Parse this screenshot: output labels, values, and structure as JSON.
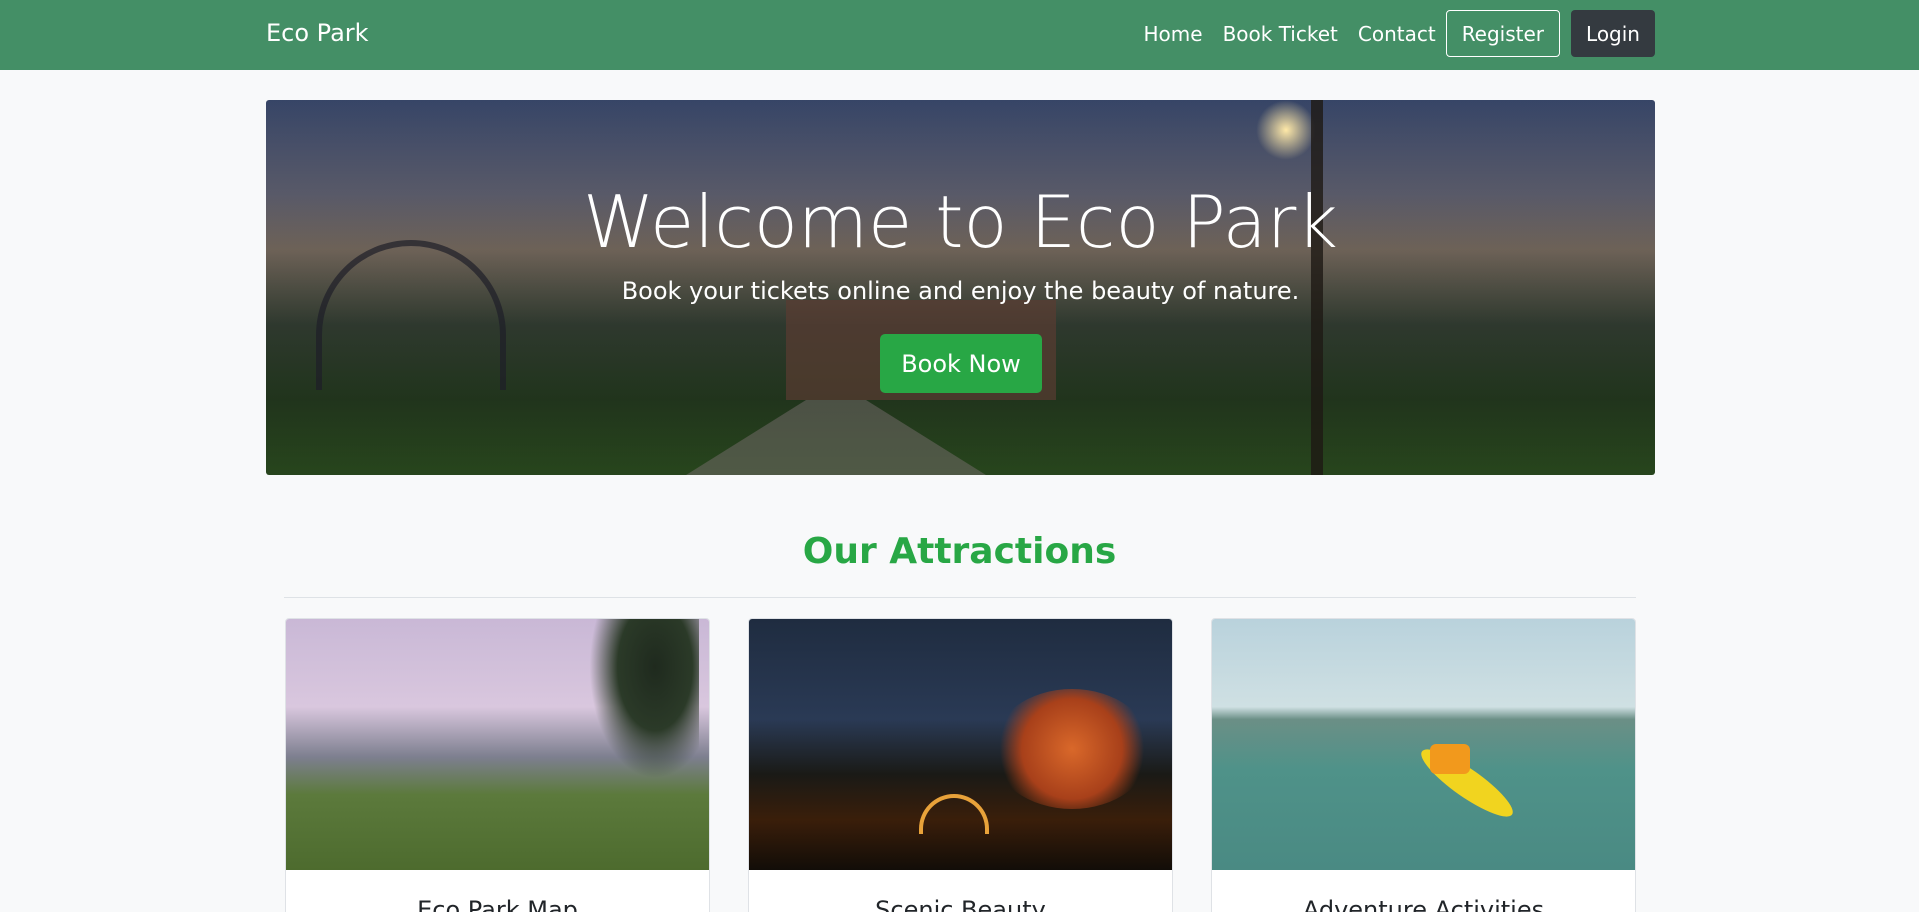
{
  "nav": {
    "brand": "Eco Park",
    "links": [
      "Home",
      "Book Ticket",
      "Contact"
    ],
    "register": "Register",
    "login": "Login"
  },
  "hero": {
    "title": "Welcome to Eco Park",
    "subtitle": "Book your tickets online and enjoy the beauty of nature.",
    "button": "Book Now"
  },
  "attractions": {
    "heading": "Our Attractions",
    "cards": [
      {
        "title": "Eco Park Map"
      },
      {
        "title": "Scenic Beauty"
      },
      {
        "title": "Adventure Activities"
      }
    ]
  },
  "colors": {
    "navbar": "#448f66",
    "accent": "#28a745",
    "login_bg": "#343a40"
  }
}
